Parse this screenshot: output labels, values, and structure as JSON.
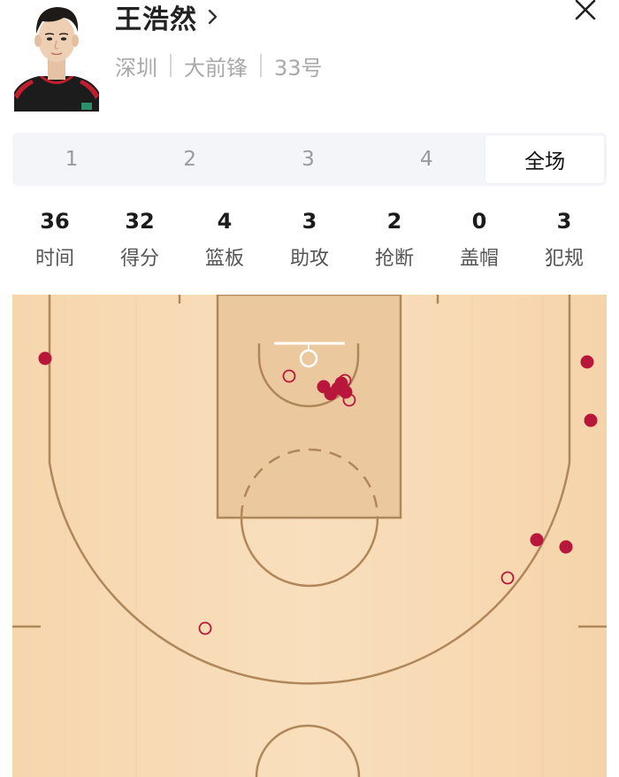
{
  "player": {
    "name": "王浩然",
    "team": "深圳",
    "position": "大前锋",
    "number": "33号"
  },
  "tabs": [
    {
      "label": "1",
      "active": false
    },
    {
      "label": "2",
      "active": false
    },
    {
      "label": "3",
      "active": false
    },
    {
      "label": "4",
      "active": false
    },
    {
      "label": "全场",
      "active": true
    }
  ],
  "stats": [
    {
      "value": "36",
      "label": "时间"
    },
    {
      "value": "32",
      "label": "得分"
    },
    {
      "value": "4",
      "label": "篮板"
    },
    {
      "value": "3",
      "label": "助攻"
    },
    {
      "value": "2",
      "label": "抢断"
    },
    {
      "value": "0",
      "label": "盖帽"
    },
    {
      "value": "3",
      "label": "犯规"
    }
  ],
  "colors": {
    "made_shot": "#b8163a",
    "missed_shot": "#b8163a",
    "court_wood": "#f7d9b2",
    "paint": "#e8c196",
    "court_line": "#b0875b",
    "active_tab_bg": "#ffffff",
    "tabs_bg": "#f3f5f9"
  },
  "icons": {
    "close": "close-icon",
    "chevron": "chevron-right-icon"
  },
  "shot_legend": {
    "made": "filled-circle",
    "missed": "hollow-circle"
  }
}
